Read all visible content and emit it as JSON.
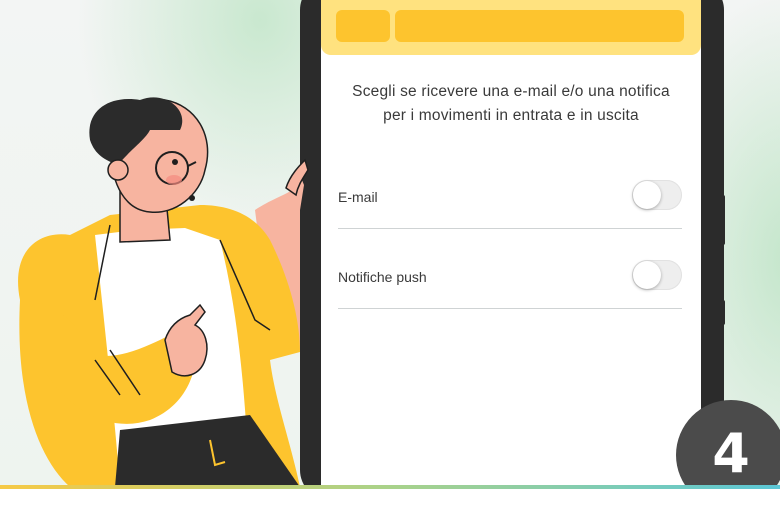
{
  "screen": {
    "description": "Scegli se ricevere una e-mail e/o una notifica per i movimenti in entrata e in uscita",
    "settings": [
      {
        "label": "E-mail",
        "enabled": false
      },
      {
        "label": "Notifiche push",
        "enabled": false
      }
    ]
  },
  "step": {
    "number": "4"
  },
  "colors": {
    "header_band": "#ffe27f",
    "header_pill": "#fdc42e",
    "badge": "#4b4b4b",
    "jacket": "#fdc42e"
  },
  "icons": {
    "character": "man-pointing-illustration"
  }
}
